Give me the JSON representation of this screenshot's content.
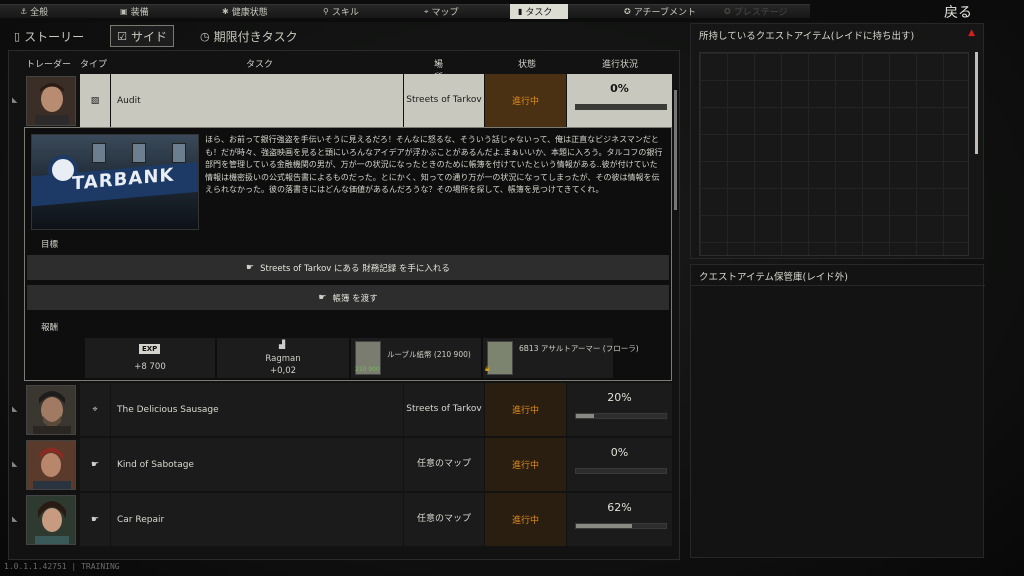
{
  "nav": {
    "items": [
      {
        "label": "全般",
        "icon": "anchor-icon"
      },
      {
        "label": "装備",
        "icon": "equipment-icon"
      },
      {
        "label": "健康状態",
        "icon": "health-icon"
      },
      {
        "label": "スキル",
        "icon": "skills-icon"
      },
      {
        "label": "マップ",
        "icon": "map-pin-icon"
      },
      {
        "label": "タスク",
        "icon": "tasks-icon"
      },
      {
        "label": "アチーブメント",
        "icon": "achievement-icon"
      },
      {
        "label": "プレステージ",
        "icon": "prestige-icon"
      }
    ],
    "active": "タスク",
    "back_label": "戻る"
  },
  "subtabs": {
    "story": "ストーリー",
    "side": "サイド",
    "timed": "期限付きタスク"
  },
  "table_headers": {
    "trader": "トレーダー",
    "type": "タイプ",
    "task": "タスク",
    "location": "場所",
    "status": "状態",
    "progress": "進行状況"
  },
  "quests": [
    {
      "name": "Audit",
      "location": "Streets of Tarkov",
      "status": "進行中",
      "progress": "0%",
      "progress_value": 0
    },
    {
      "name": "The Delicious Sausage",
      "location": "Streets of Tarkov",
      "status": "進行中",
      "progress": "20%",
      "progress_value": 0.2
    },
    {
      "name": "Kind of Sabotage",
      "location": "任意のマップ",
      "status": "進行中",
      "progress": "0%",
      "progress_value": 0
    },
    {
      "name": "Car Repair",
      "location": "任意のマップ",
      "status": "進行中",
      "progress": "62%",
      "progress_value": 0.62
    }
  ],
  "details": {
    "banner_text": "TARBANK",
    "description": "ほら、お前って銀行強盗を手伝いそうに見えるだろ！そんなに怒るな、そういう話じゃないって、俺は正直なビジネスマンだとも！だが時々、強盗映画を見ると頭にいろんなアイデアが浮かぶことがあるんだよ.まぁいいか、本題に入ろう。タルコフの銀行部門を管理している金融機関の男が、万が一の状況になったときのために帳簿を付けていたという情報がある..彼が付けていた情報は機密扱いの公式報告書によるものだった。とにかく、知っての通り万が一の状況になってしまったが、その彼は情報を伝えられなかった。彼の落書きにはどんな価値があるんだろうな？その場所を探して、帳簿を見つけてきてくれ。",
    "objectives_label": "目標",
    "objective1": "Streets of Tarkov にある 財務記録 を手に入れる",
    "objective2": "帳簿 を渡す",
    "rewards_label": "報酬",
    "rewards": {
      "exp_badge": "EXP",
      "exp_value": "+8 700",
      "rep_trader": "Ragman",
      "rep_value": "+0,02",
      "money_name": "ルーブル紙幣 (210 900)",
      "money_small": "210 900",
      "armor_name": "6B13 アサルトアーマー (フローラ)"
    }
  },
  "right": {
    "carried_title": "所持しているクエストアイテム(レイドに持ち出す)",
    "stash_title": "クエストアイテム保管庫(レイド外)"
  },
  "version": "1.0.1.1.42751 | TRAINING"
}
